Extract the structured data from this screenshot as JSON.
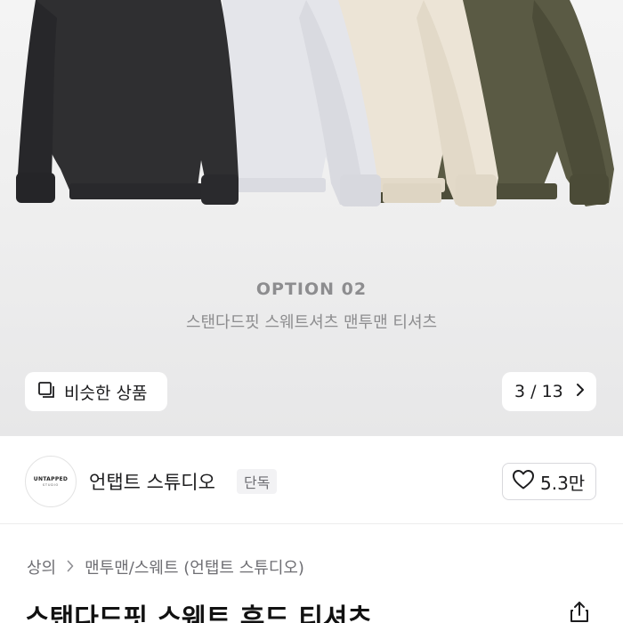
{
  "hero": {
    "option_title": "OPTION 02",
    "option_subtitle": "스탠다드핏 스웨트셔츠 맨투맨 티셔츠",
    "similar_button_label": "비슷한 상품",
    "similar_icon": "similar-items-icon",
    "image_counter": "3 / 13",
    "next_icon": "chevron-right-icon",
    "garment_colors": [
      "#2f2f31",
      "#e4e5ea",
      "#ece4d6",
      "#5a5a44"
    ]
  },
  "brand": {
    "logo_line1": "UNTAPPED",
    "logo_line2": "STUDIO",
    "name": "언탭트 스튜디오",
    "badge": "단독",
    "like_icon": "heart-outline-icon",
    "like_count": "5.3만"
  },
  "breadcrumb": {
    "items": [
      "상의",
      "맨투맨/스웨트 (언탭트 스튜디오)"
    ],
    "separator_icon": "chevron-right-icon"
  },
  "product": {
    "title": "스탠다드핏 스웨트 후드 티셔츠",
    "share_icon": "share-icon"
  }
}
